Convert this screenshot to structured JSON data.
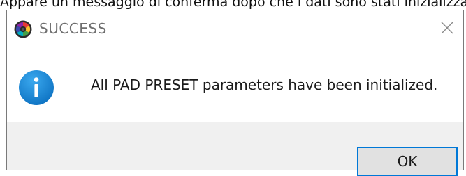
{
  "caption": {
    "text": "Appare un messaggio di conferma dopo che i dati sono stati inizializzati."
  },
  "dialog": {
    "title": "SUCCESS",
    "app_icon": "color-wheel-app-icon",
    "close_icon": "close-icon",
    "message": "All PAD PRESET parameters have been initialized.",
    "message_icon": "info-icon",
    "ok_label": "OK",
    "colors": {
      "info_blue": "#1a8fd8",
      "ok_border": "#0078d7",
      "footer_bg": "#f0f0f0",
      "title_text": "#6e6e6e"
    }
  }
}
